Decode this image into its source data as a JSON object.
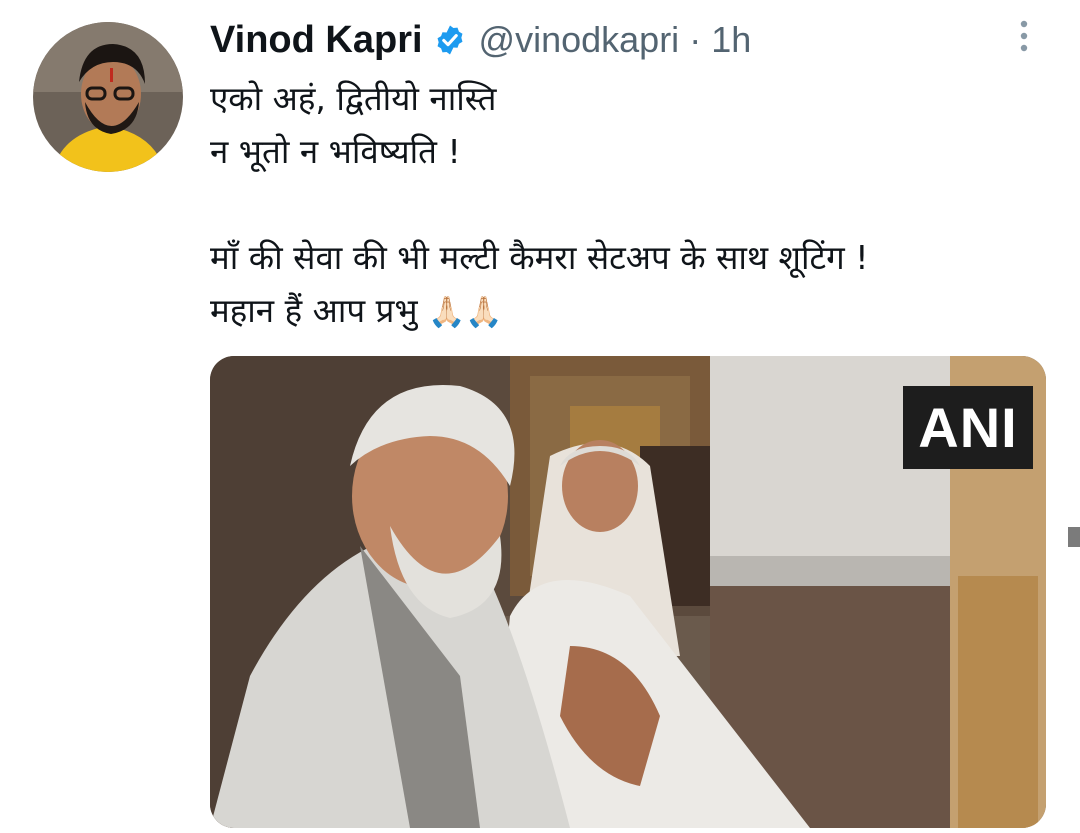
{
  "tweet": {
    "author_name": "Vinod Kapri",
    "handle": "@vinodkapri",
    "separator": "·",
    "time": "1h",
    "verified_icon": "verified-badge-icon",
    "more_icon": "more-vertical-icon",
    "avatar_icon": "avatar",
    "text_lines": [
      "एको अहं, द्वितीयो नास्ति",
      "न भूतो न भविष्यति !",
      "",
      "माँ की सेवा की भी मल्टी कैमरा सेटअप के साथ शूटिंग !",
      "महान हैं आप प्रभु "
    ],
    "emojis": "🙏🏻🙏🏻",
    "media": {
      "watermark": "ANI"
    }
  },
  "colors": {
    "text": "#0f1419",
    "secondary": "#536471",
    "verified": "#1d9bf0"
  }
}
